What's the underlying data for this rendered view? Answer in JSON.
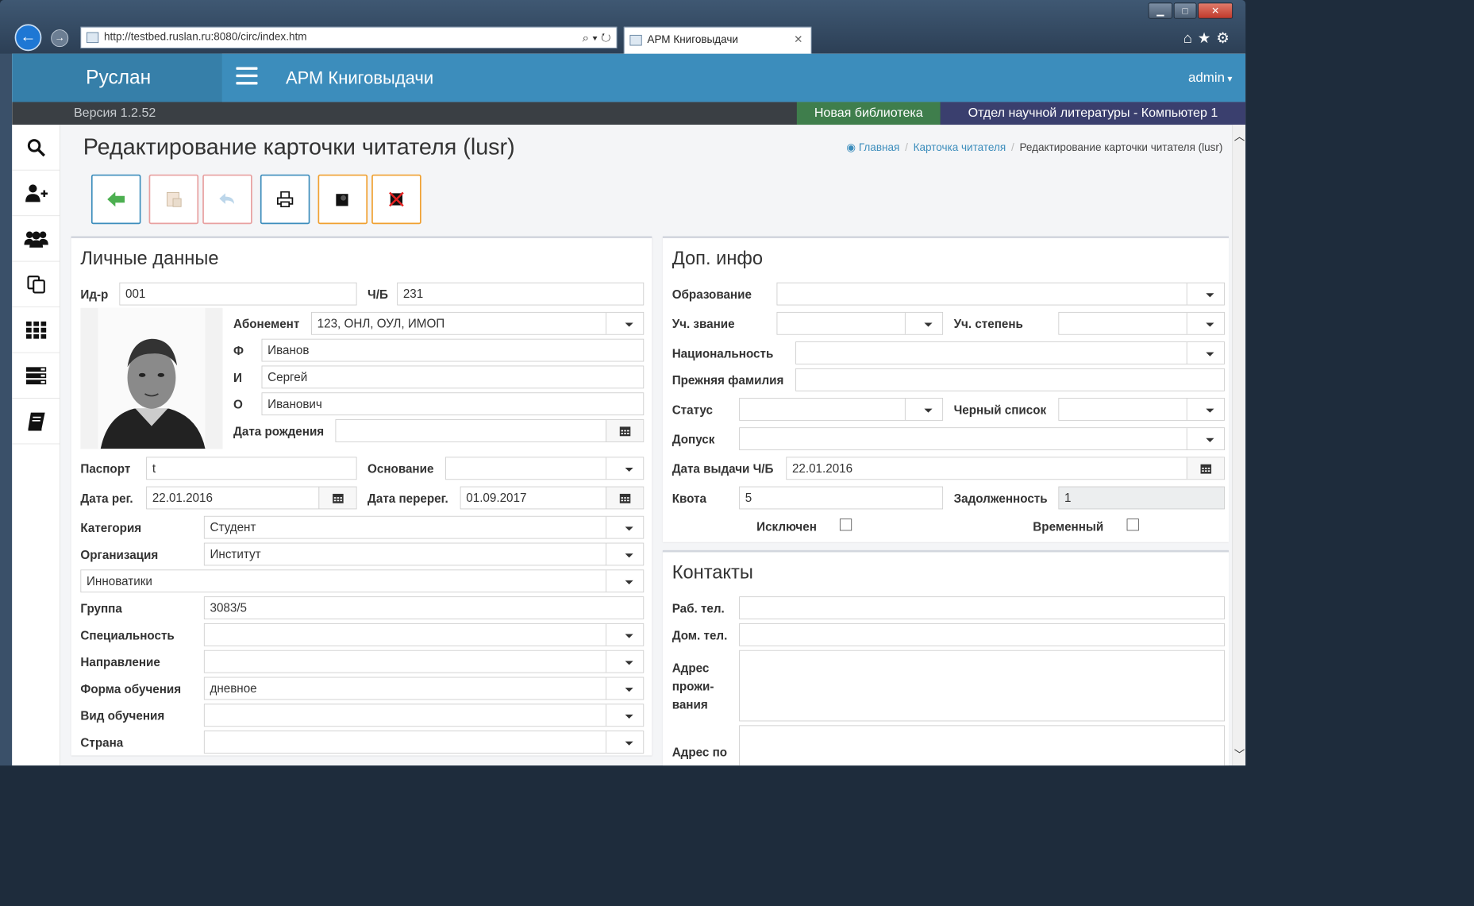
{
  "browser": {
    "url": "http://testbed.ruslan.ru:8080/circ/index.htm",
    "tab_title": "АРМ Книговыдачи"
  },
  "header": {
    "brand": "Руслан",
    "app_title": "АРМ Книговыдачи",
    "user": "admin"
  },
  "statusbar": {
    "version": "Версия 1.2.52",
    "library": "Новая библиотека",
    "department": "Отдел научной литературы - Компьютер 1"
  },
  "page": {
    "title": "Редактирование карточки читателя (lusr)",
    "breadcrumb": {
      "home": "Главная",
      "card": "Карточка читателя",
      "current": "Редактирование карточки читателя (lusr)"
    }
  },
  "personal": {
    "title": "Личные данные",
    "id_label": "Ид-р",
    "id_value": "001",
    "cb_label": "Ч/Б",
    "cb_value": "231",
    "abonement_label": "Абонемент",
    "abonement_value": "123, ОНЛ, ОУЛ, ИМОП",
    "f_label": "Ф",
    "f_value": "Иванов",
    "i_label": "И",
    "i_value": "Сергей",
    "o_label": "О",
    "o_value": "Иванович",
    "birth_label": "Дата рождения",
    "birth_value": "",
    "passport_label": "Паспорт",
    "passport_value": "t",
    "basis_label": "Основание",
    "basis_value": "",
    "reg_label": "Дата рег.",
    "reg_value": "22.01.2016",
    "rereg_label": "Дата перерег.",
    "rereg_value": "01.09.2017",
    "category_label": "Категория",
    "category_value": "Студент",
    "org_label": "Организация",
    "org_value": "Институт",
    "subdiv_value": "Инноватики",
    "group_label": "Группа",
    "group_value": "3083/5",
    "spec_label": "Специальность",
    "spec_value": "",
    "direction_label": "Направление",
    "direction_value": "",
    "form_label": "Форма обучения",
    "form_value": "дневное",
    "kind_label": "Вид обучения",
    "kind_value": "",
    "country_label": "Страна",
    "country_value": ""
  },
  "extra": {
    "title": "Доп. инфо",
    "education_label": "Образование",
    "education_value": "",
    "rank_label": "Уч. звание",
    "rank_value": "",
    "degree_label": "Уч. степень",
    "degree_value": "",
    "nation_label": "Национальность",
    "nation_value": "",
    "prevname_label": "Прежняя фамилия",
    "prevname_value": "",
    "status_label": "Статус",
    "status_value": "",
    "blacklist_label": "Черный список",
    "blacklist_value": "",
    "access_label": "Допуск",
    "access_value": "",
    "issue_label": "Дата выдачи Ч/Б",
    "issue_value": "22.01.2016",
    "quota_label": "Квота",
    "quota_value": "5",
    "debt_label": "Задолженность",
    "debt_value": "1",
    "excluded_label": "Исключен",
    "temporary_label": "Временный"
  },
  "contacts": {
    "title": "Контакты",
    "work_label": "Раб. тел.",
    "work_value": "",
    "home_label": "Дом. тел.",
    "home_value": "",
    "addr_label": "Адрес\nпрожи-\nвания",
    "addr2_label": "Адрес по"
  },
  "colors": {
    "header": "#3c8dbc",
    "brand": "#367fa9",
    "library": "#3f7e4c",
    "department": "#3a3f6e"
  }
}
